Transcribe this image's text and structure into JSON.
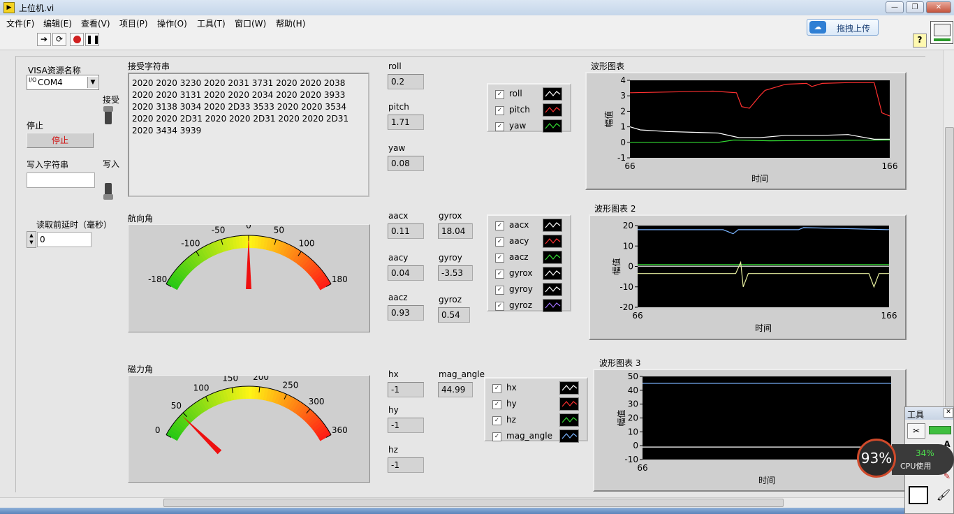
{
  "window": {
    "title": "上位机.vi",
    "icon": "labview-vi-icon"
  },
  "menu": [
    "文件(F)",
    "编辑(E)",
    "查看(V)",
    "项目(P)",
    "操作(O)",
    "工具(T)",
    "窗口(W)",
    "帮助(H)"
  ],
  "toolbar": {
    "upload_label": "拖拽上传",
    "help": "?"
  },
  "controls": {
    "visa_label": "VISA资源名称",
    "visa_prefix": "I/O",
    "visa_value": "COM4",
    "receive_label": "接受",
    "stop_label": "停止",
    "stop_button": "停止",
    "write_string_label": "写入字符串",
    "write_string_value": "",
    "write_label": "写入",
    "delay_label": "读取前延时（毫秒）",
    "delay_value": "0"
  },
  "received": {
    "label": "接受字符串",
    "text": "2020 2020 3230 2020 2031 3731 2020 2020 2038 2020 2020 3131 2020 2020 2034 2020 2020 3933 2020 3138 3034 2020 2D33 3533 2020 2020 3534 2020 2020 2D31 2020 2020 2D31 2020 2020 2D31 2020 3434 3939"
  },
  "orientation": [
    {
      "label": "roll",
      "value": "0.2"
    },
    {
      "label": "pitch",
      "value": "1.71"
    },
    {
      "label": "yaw",
      "value": "0.08"
    }
  ],
  "accel": [
    {
      "label": "aacx",
      "value": "0.11"
    },
    {
      "label": "aacy",
      "value": "0.04"
    },
    {
      "label": "aacz",
      "value": "0.93"
    }
  ],
  "gyro": [
    {
      "label": "gyrox",
      "value": "18.04"
    },
    {
      "label": "gyroy",
      "value": "-3.53"
    },
    {
      "label": "gyroz",
      "value": "0.54"
    }
  ],
  "mag": [
    {
      "label": "hx",
      "value": "-1"
    },
    {
      "label": "hy",
      "value": "-1"
    },
    {
      "label": "hz",
      "value": "-1"
    }
  ],
  "mag_angle": {
    "label": "mag_angle",
    "value": "44.99"
  },
  "legend1": [
    {
      "name": "roll",
      "color": "#ffffff"
    },
    {
      "name": "pitch",
      "color": "#ff3030"
    },
    {
      "name": "yaw",
      "color": "#33dd33"
    }
  ],
  "legend2": [
    {
      "name": "aacx",
      "color": "#ffffff"
    },
    {
      "name": "aacy",
      "color": "#ff3030"
    },
    {
      "name": "aacz",
      "color": "#33dd33"
    },
    {
      "name": "gyrox",
      "color": "#ffffff"
    },
    {
      "name": "gyroy",
      "color": "#ffffff"
    },
    {
      "name": "gyroz",
      "color": "#a070ff"
    }
  ],
  "legend3": [
    {
      "name": "hx",
      "color": "#ffffff"
    },
    {
      "name": "hy",
      "color": "#ff3030"
    },
    {
      "name": "hz",
      "color": "#33dd33"
    },
    {
      "name": "mag_angle",
      "color": "#7ab4ff"
    }
  ],
  "gauges": {
    "heading": {
      "label": "航向角",
      "ticks": [
        "-180",
        "-100",
        "-50",
        "0",
        "50",
        "100",
        "180"
      ],
      "min": -180,
      "max": 180,
      "value": 0
    },
    "magnetic": {
      "label": "磁力角",
      "ticks": [
        "0",
        "50",
        "100",
        "150",
        "200",
        "250",
        "300",
        "360"
      ],
      "min": 0,
      "max": 360,
      "value": 45
    }
  },
  "chart_data": [
    {
      "type": "line",
      "title": "波形图表",
      "xlabel": "时间",
      "ylabel": "幅值",
      "xlim": [
        66,
        166
      ],
      "ylim": [
        -1,
        4
      ],
      "yticks": [
        "4",
        "3",
        "2",
        "1",
        "0",
        "-1"
      ],
      "xticks": [
        "66",
        "166"
      ],
      "grid": false,
      "series": [
        {
          "name": "pitch",
          "color": "#ff3030",
          "x": [
            66,
            98,
            107,
            109,
            112,
            116,
            118,
            126,
            134,
            136,
            140,
            150,
            160,
            163,
            166
          ],
          "y": [
            3.2,
            3.3,
            3.2,
            2.3,
            2.2,
            3.0,
            3.35,
            3.75,
            3.8,
            3.6,
            3.8,
            3.85,
            3.85,
            1.9,
            1.7
          ]
        },
        {
          "name": "roll",
          "color": "#ffffff",
          "x": [
            66,
            70,
            80,
            90,
            100,
            108,
            116,
            126,
            140,
            150,
            160,
            166
          ],
          "y": [
            1.0,
            0.8,
            0.7,
            0.65,
            0.6,
            0.3,
            0.3,
            0.45,
            0.45,
            0.5,
            0.2,
            0.2
          ]
        },
        {
          "name": "yaw",
          "color": "#33dd33",
          "x": [
            66,
            100,
            106,
            120,
            140,
            166
          ],
          "y": [
            0.0,
            0.0,
            0.15,
            0.1,
            0.12,
            0.15
          ]
        }
      ]
    },
    {
      "type": "line",
      "title": "波形图表 2",
      "xlabel": "时间",
      "ylabel": "幅值",
      "xlim": [
        66,
        166
      ],
      "ylim": [
        -20,
        20
      ],
      "yticks": [
        "20",
        "10",
        "0",
        "-10",
        "-20"
      ],
      "xticks": [
        "66",
        "166"
      ],
      "grid": false,
      "series": [
        {
          "name": "gyrox",
          "color": "#7ab4ff",
          "x": [
            66,
            100,
            104,
            106,
            130,
            132,
            166
          ],
          "y": [
            18,
            18,
            16,
            18,
            18,
            19,
            18
          ]
        },
        {
          "name": "aacz",
          "color": "#33dd33",
          "x": [
            66,
            166
          ],
          "y": [
            0.9,
            0.9
          ]
        },
        {
          "name": "aacx",
          "color": "#ffffff",
          "x": [
            66,
            166
          ],
          "y": [
            0.1,
            0.1
          ]
        },
        {
          "name": "gyroy",
          "color": "#e8f0a0",
          "x": [
            66,
            105,
            107,
            108,
            110,
            130,
            150,
            158,
            160,
            162,
            166
          ],
          "y": [
            -3.5,
            -3.5,
            2,
            -10,
            -3.5,
            -3.5,
            -3.5,
            -3.5,
            -10,
            -3.5,
            -3.5
          ]
        }
      ]
    },
    {
      "type": "line",
      "title": "波形图表 3",
      "xlabel": "时间",
      "ylabel": "幅值",
      "xlim": [
        66,
        166
      ],
      "ylim": [
        -10,
        50
      ],
      "yticks": [
        "50",
        "40",
        "30",
        "20",
        "10",
        "0",
        "-10"
      ],
      "xticks": [
        "66"
      ],
      "grid": false,
      "series": [
        {
          "name": "mag_angle",
          "color": "#7ab4ff",
          "x": [
            66,
            166
          ],
          "y": [
            45,
            45
          ]
        },
        {
          "name": "hx",
          "color": "#ffffff",
          "x": [
            66,
            166
          ],
          "y": [
            -1,
            -1
          ]
        }
      ]
    }
  ],
  "tools_palette": {
    "title": "工具"
  },
  "cpu": {
    "percent": "93%",
    "cpu_usage": "34%",
    "cpu_label": "CPU使用"
  }
}
